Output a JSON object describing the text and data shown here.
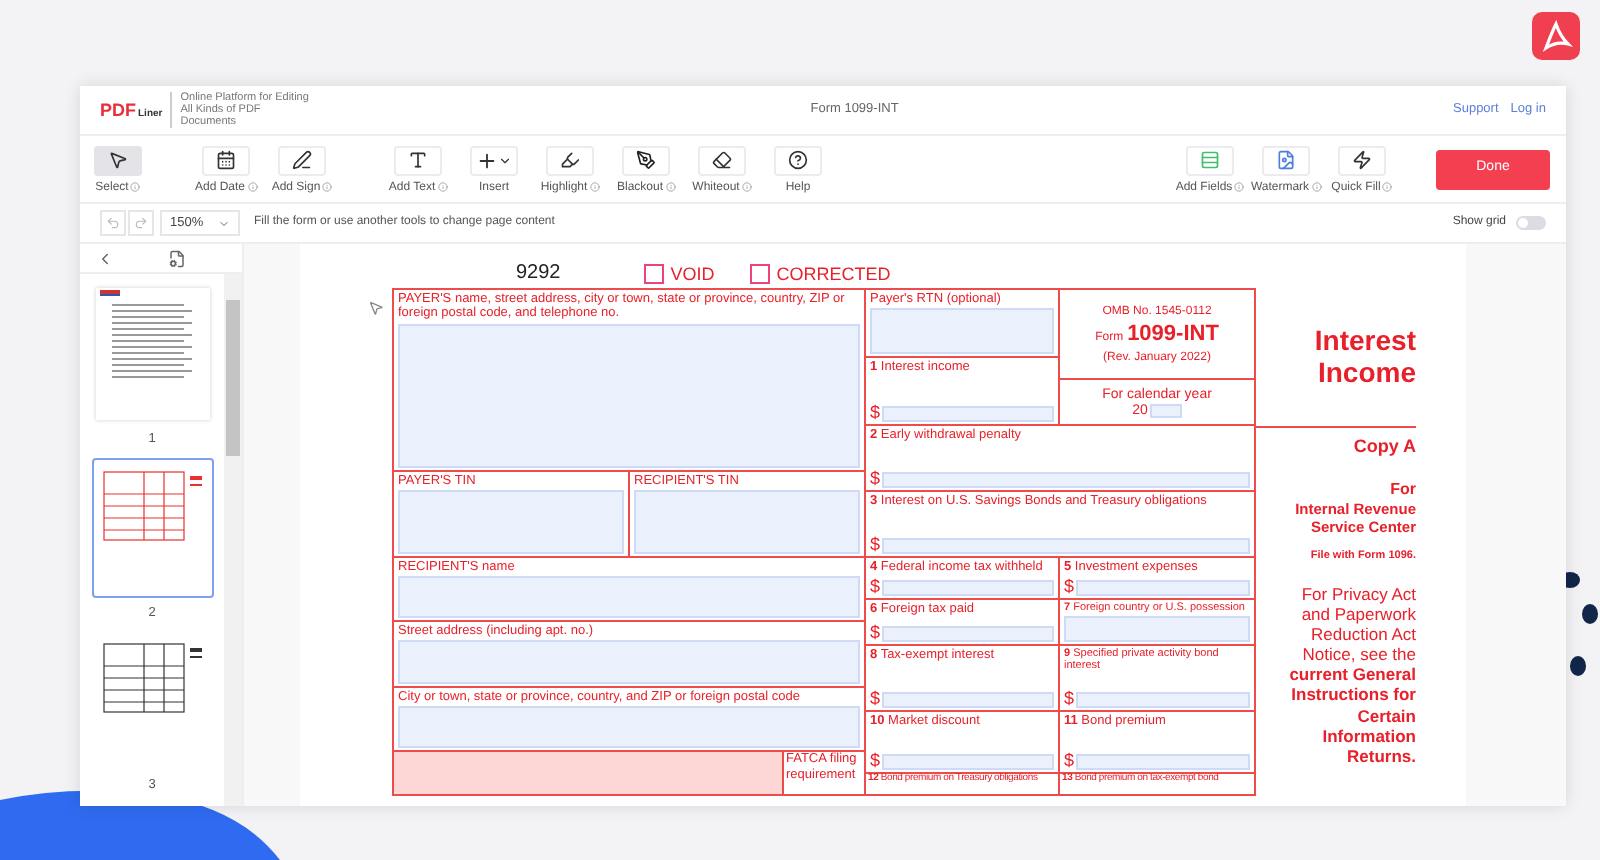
{
  "app": {
    "logo_main": "PDF",
    "logo_sub": "Liner",
    "tagline": "Online Platform for Editing All Kinds of PDF Documents"
  },
  "title": "Form 1099-INT",
  "links": [
    "Support",
    "Log in"
  ],
  "tool_groups": [
    {
      "tools": [
        {
          "label": "Select",
          "info": true,
          "selected": true
        }
      ]
    },
    {
      "tools": [
        {
          "label": "Add Date",
          "info": true,
          "selected": false
        },
        {
          "label": "Add Sign",
          "info": true,
          "selected": false
        }
      ]
    },
    {
      "tools": [
        {
          "label": "Add Text",
          "info": true,
          "selected": false
        },
        {
          "label": "Insert",
          "info": false,
          "selected": false
        },
        {
          "label": "Highlight",
          "info": true,
          "selected": false
        },
        {
          "label": "Blackout",
          "info": true,
          "selected": false
        },
        {
          "label": "Whiteout",
          "info": true,
          "selected": false
        },
        {
          "label": "Help",
          "info": false,
          "selected": false
        }
      ]
    }
  ],
  "right_tools": [
    {
      "label": "Add Fields",
      "info": true
    },
    {
      "label": "Watermark",
      "info": true
    },
    {
      "label": "Quick Fill",
      "info": true
    }
  ],
  "done_button": "Done",
  "zoom": "150%",
  "hint": "Fill the form or use another tools to change page content",
  "show_grid": {
    "label": "Show grid",
    "on": false
  },
  "pages": [
    {
      "label": "1",
      "kind": "letter",
      "selected": false
    },
    {
      "label": "2",
      "kind": "red-form",
      "selected": true
    },
    {
      "label": "3",
      "kind": "form",
      "selected": false
    }
  ],
  "form": {
    "number": "9292",
    "checkboxes": [
      {
        "label": "VOID",
        "checked": false
      },
      {
        "label": "CORRECTED",
        "checked": false
      }
    ],
    "cells": [
      {
        "kind": "field",
        "label": "PAYER'S name, street address, city or town, state or province, country, ZIP or foreign postal code, and telephone no."
      },
      {
        "kind": "field",
        "label": "PAYER'S TIN"
      },
      {
        "kind": "field",
        "label": "RECIPIENT'S TIN"
      },
      {
        "kind": "field",
        "label": "RECIPIENT'S name"
      },
      {
        "kind": "field",
        "label": "Street address (including apt. no.)"
      },
      {
        "kind": "field",
        "label": "City or town, state or province, country, and ZIP or foreign postal code"
      },
      {
        "kind": "fatca",
        "label": "FATCA filing requirement"
      },
      {
        "kind": "field",
        "label": "Payer's RTN (optional)"
      },
      {
        "kind": "field",
        "label": "**1** Interest income",
        "prefix": "$"
      },
      {
        "kind": "omb",
        "omb": "OMB No. 1545-0112",
        "form_prefix": "Form",
        "form_name": "1099-INT",
        "rev": "(Rev. January 2022)"
      },
      {
        "kind": "calendar",
        "label": "For calendar year",
        "year": "20"
      },
      {
        "kind": "field",
        "label": "**2** Early withdrawal penalty",
        "prefix": "$"
      },
      {
        "kind": "field",
        "label": "**3** Interest on U.S. Savings Bonds and Treasury obligations",
        "prefix": "$"
      },
      {
        "kind": "field",
        "label": "**4** Federal income tax withheld",
        "prefix": "$"
      },
      {
        "kind": "field",
        "label": "**5** Investment expenses",
        "prefix": "$"
      },
      {
        "kind": "field",
        "label": "**6** Foreign tax paid",
        "prefix": "$"
      },
      {
        "kind": "field",
        "label": "**7** Foreign country or U.S. possession"
      },
      {
        "kind": "field",
        "label": "**8** Tax-exempt interest",
        "prefix": "$"
      },
      {
        "kind": "field",
        "label": "**9** Specified private activity bond interest",
        "prefix": "$"
      },
      {
        "kind": "field",
        "label": "**10** Market discount",
        "prefix": "$"
      },
      {
        "kind": "field",
        "label": "**11** Bond premium",
        "prefix": "$"
      },
      {
        "kind": "heading",
        "label": "**12** Bond premium on Treasury obligations"
      },
      {
        "kind": "heading",
        "label": "**13** Bond premium on tax-exempt bond"
      }
    ]
  },
  "side": {
    "title": "Interest Income",
    "copy": "Copy A",
    "for": "For",
    "center": "Internal Revenue Service Center",
    "file_with": "File with Form 1096.",
    "notice": "For Privacy Act and Paperwork Reduction Act Notice, see the **current General Instructions for Certain Information Returns.**"
  }
}
